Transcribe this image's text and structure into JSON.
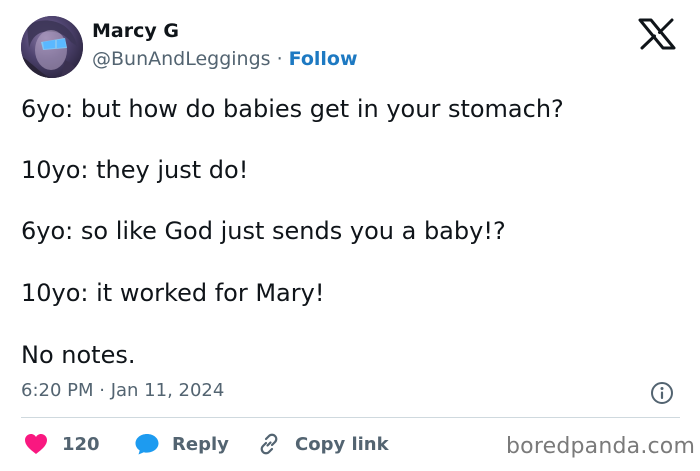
{
  "author": {
    "name": "Marcy G",
    "handle": "@BunAndLeggings",
    "separator": "·",
    "follow_label": "Follow"
  },
  "tweet": {
    "lines": [
      "6yo: but how do babies get in your stomach?",
      "10yo: they just do!",
      "6yo: so like God just sends you a baby!?",
      "10yo: it worked for Mary!",
      "No notes."
    ],
    "timestamp": "6:20 PM · Jan 11, 2024"
  },
  "actions": {
    "like_count": "120",
    "reply_label": "Reply",
    "copy_link_label": "Copy link"
  },
  "watermark": "boredpanda.com",
  "icons": {
    "brand": "x-logo-icon",
    "info": "info-icon",
    "like": "heart-icon",
    "reply": "speech-bubble-icon",
    "copy": "link-icon"
  },
  "colors": {
    "text": "#0f1419",
    "secondary": "#536471",
    "link": "#1d79c2",
    "heart": "#f91880",
    "reply_bubble": "#1d9bf0",
    "divider": "#cfd9de"
  }
}
